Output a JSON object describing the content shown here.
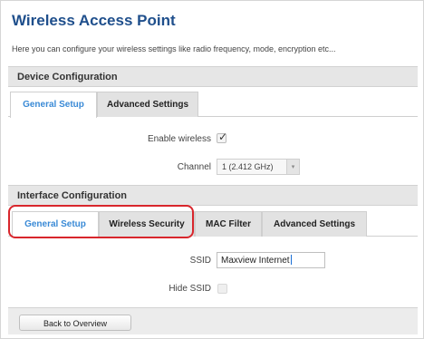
{
  "page": {
    "title": "Wireless Access Point",
    "description": "Here you can configure your wireless settings like radio frequency, mode, encryption etc..."
  },
  "device_configuration": {
    "header": "Device Configuration",
    "tabs": [
      {
        "label": "General Setup",
        "active": true
      },
      {
        "label": "Advanced Settings",
        "active": false
      }
    ],
    "enable_wireless": {
      "label": "Enable wireless",
      "checked": true
    },
    "channel": {
      "label": "Channel",
      "value": "1 (2.412 GHz)"
    }
  },
  "interface_configuration": {
    "header": "Interface Configuration",
    "tabs": [
      {
        "label": "General Setup",
        "active": true
      },
      {
        "label": "Wireless Security",
        "active": false
      },
      {
        "label": "MAC Filter",
        "active": false
      },
      {
        "label": "Advanced Settings",
        "active": false
      }
    ],
    "ssid": {
      "label": "SSID",
      "value": "Maxview Internet"
    },
    "hide_ssid": {
      "label": "Hide SSID",
      "checked": false
    }
  },
  "footer": {
    "back_button_label": "Back to Overview"
  },
  "colors": {
    "title": "#1f4f8c",
    "active_tab_text": "#3a8ad6",
    "highlight_outline": "#d8262c"
  },
  "icons": {
    "checkbox_tick": "checkmark-icon",
    "select_caret": "chevron-down-icon"
  }
}
